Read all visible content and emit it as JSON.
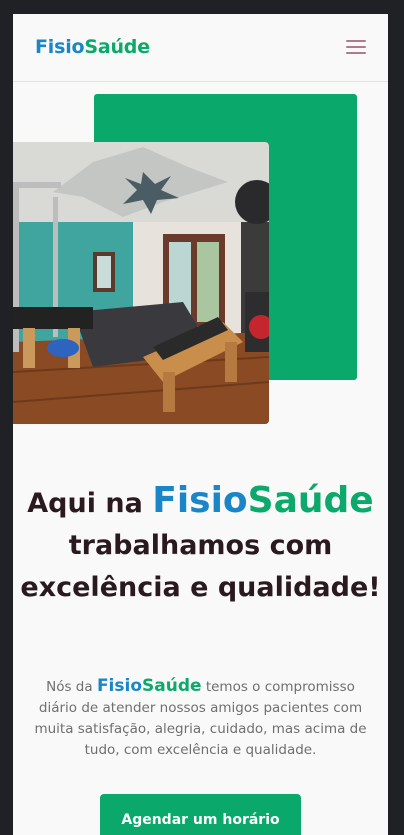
{
  "brand": {
    "part1": "Fisio",
    "part2": "Saúde",
    "accent_blue": "#1a86c7",
    "accent_green": "#0ca86c"
  },
  "nav": {
    "menu_icon": "hamburger-menu-icon"
  },
  "hero": {
    "image_alt": "Pilates studio room",
    "headline_before": "Aqui na ",
    "headline_after": " trabalhamos com excelência e qualidade!",
    "lead_before": "Nós da ",
    "lead_after": " temos o compromisso diário de atender nossos amigos pacientes com muita satisfação, alegria, cuidado, mas acima de tudo, com excelência e qualidade.",
    "cta_label": "Agendar um horário"
  },
  "colors": {
    "primary_green": "#0aa86a",
    "page_bg": "#f9f9f9",
    "frame_bg": "#202124"
  }
}
